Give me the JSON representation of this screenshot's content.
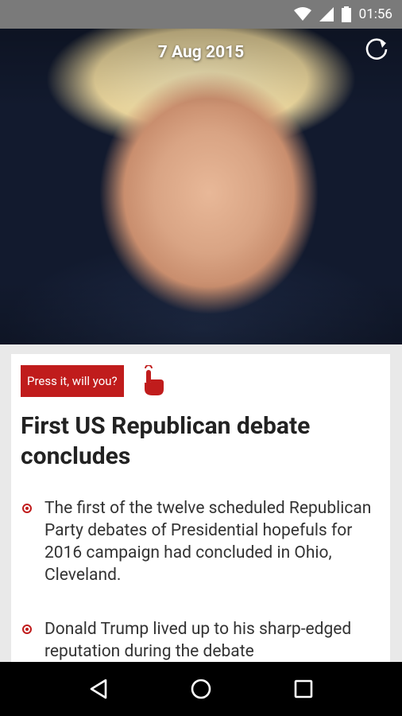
{
  "status_bar": {
    "time": "01:56",
    "icons": [
      "wifi-icon",
      "signal-icon",
      "battery-icon"
    ]
  },
  "hero": {
    "date": "7 Aug 2015",
    "refresh_icon": "refresh-icon"
  },
  "article": {
    "press_label": "Press it, will you?",
    "tap_icon": "hand-tap-icon",
    "headline": "First US Republican debate concludes",
    "bullets": [
      "The first of the twelve scheduled Republican Party debates of Presidential hopefuls for 2016 campaign had concluded in Ohio, Cleveland.",
      "Donald Trump lived up to his sharp-edged reputation during the debate"
    ]
  },
  "nav_bar": {
    "buttons": [
      "back-icon",
      "home-icon",
      "recents-icon"
    ]
  },
  "colors": {
    "accent": "#c01c1c",
    "status_bar": "#7a7a7a",
    "nav_bar": "#000000",
    "article_bg": "#e9e9e9"
  }
}
